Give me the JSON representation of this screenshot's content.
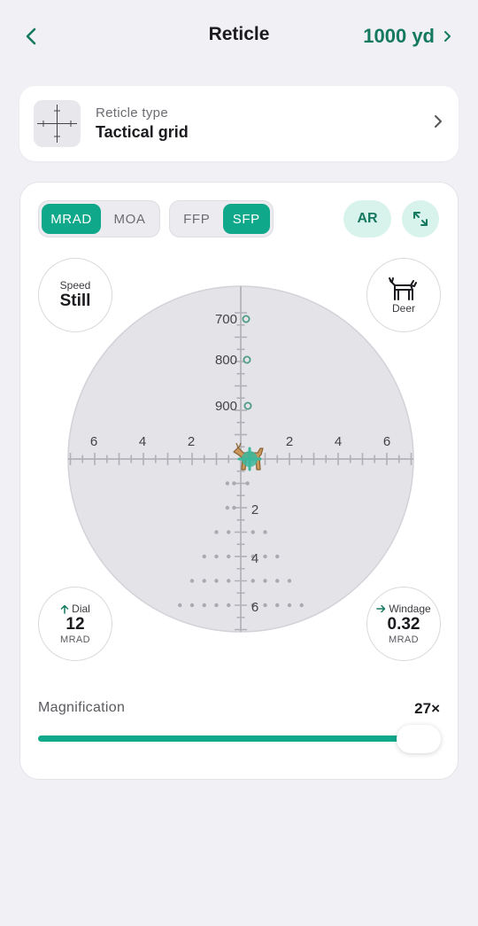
{
  "header": {
    "title": "Reticle",
    "range_label": "1000 yd"
  },
  "reticle": {
    "label": "Reticle type",
    "value": "Tactical grid"
  },
  "unit_toggle": {
    "options": [
      "MRAD",
      "MOA"
    ],
    "selected": "MRAD"
  },
  "plane_toggle": {
    "options": [
      "FFP",
      "SFP"
    ],
    "selected": "SFP"
  },
  "ar_label": "AR",
  "speed": {
    "label": "Speed",
    "value": "Still"
  },
  "target": {
    "label": "Deer",
    "icon": "deer-icon"
  },
  "dial": {
    "label": "Dial",
    "value": "12",
    "unit": "MRAD"
  },
  "windage": {
    "label": "Windage",
    "value": "0.32",
    "unit": "MRAD"
  },
  "scope": {
    "range_marks": [
      "700",
      "800",
      "900"
    ],
    "h_labels_left": [
      "6",
      "4",
      "2"
    ],
    "h_labels_right": [
      "2",
      "4",
      "6"
    ],
    "v_labels": [
      "2",
      "4",
      "6"
    ]
  },
  "magnification": {
    "label": "Magnification",
    "value": "27×",
    "fraction": 0.95
  },
  "colors": {
    "accent": "#0fa88a",
    "accent_dark": "#14795f",
    "accent_light": "#d8f3ec",
    "scope_bg": "#e3e3e8"
  }
}
